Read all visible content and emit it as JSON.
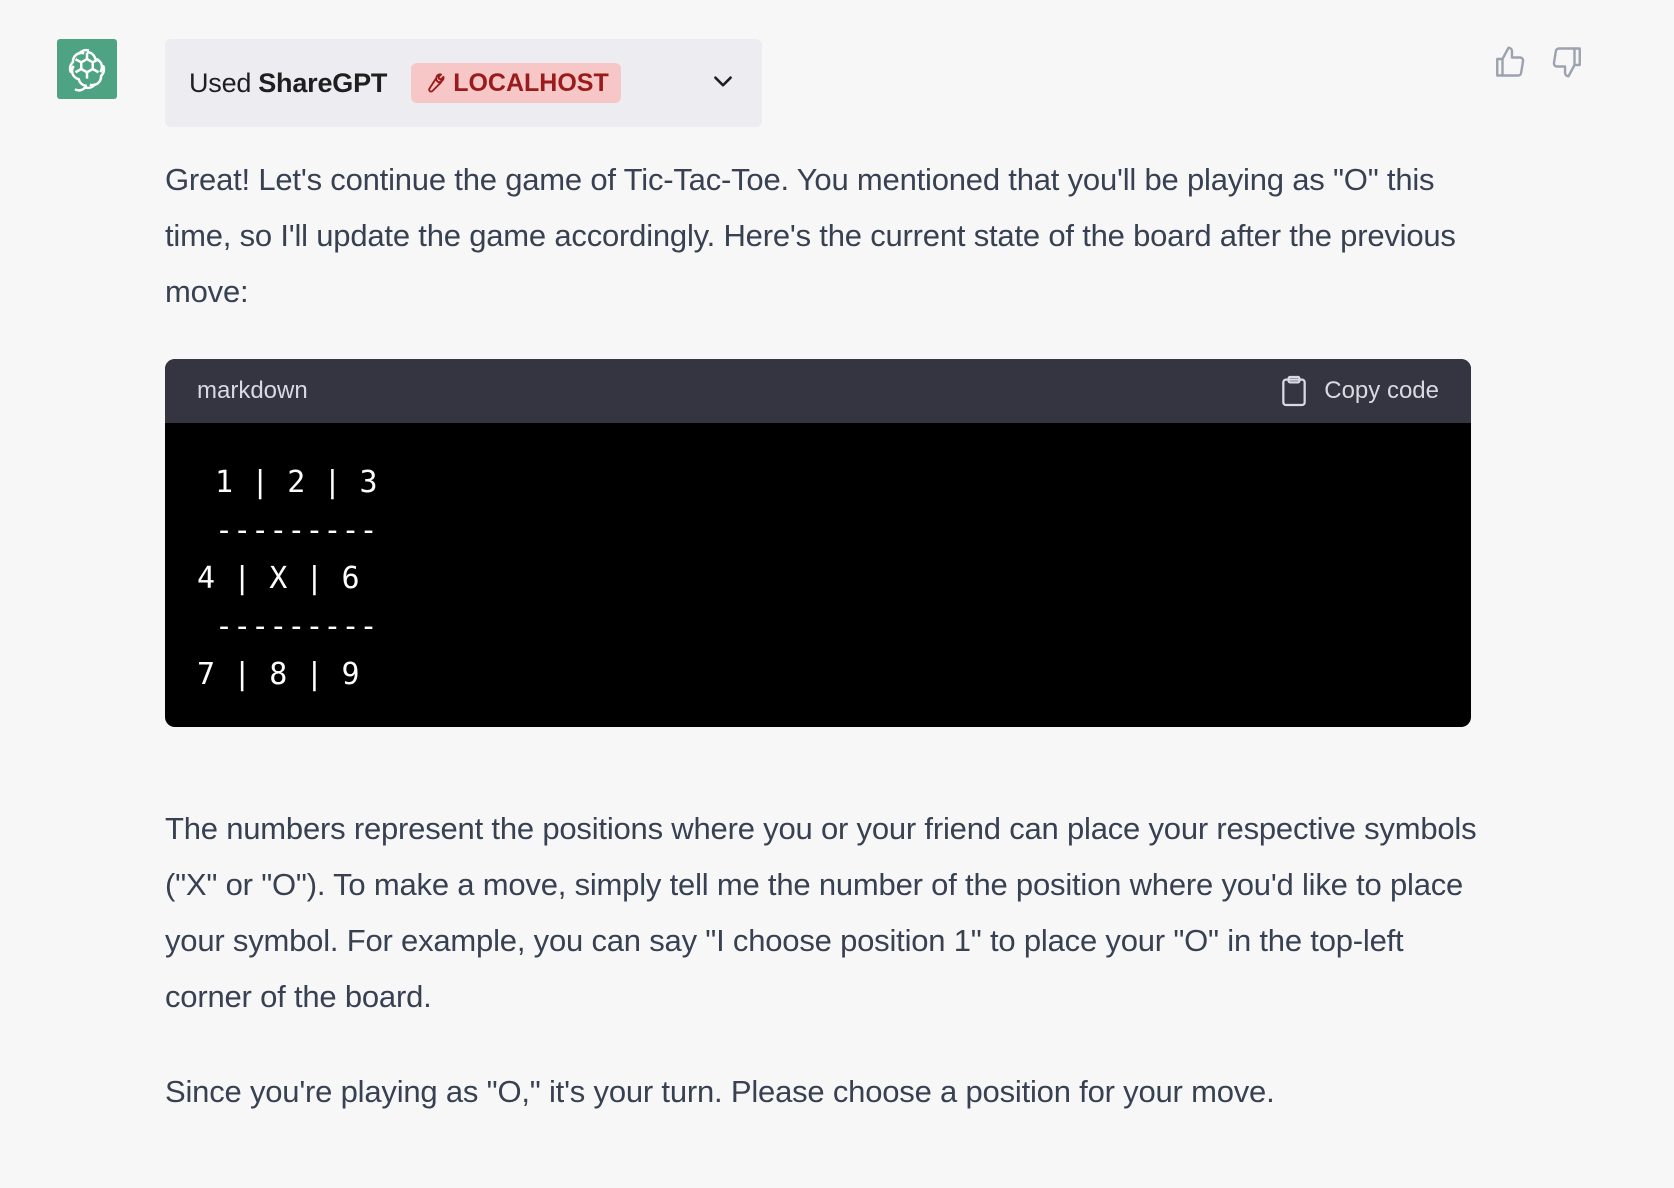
{
  "assistant": {
    "avatar_icon": "openai-logo-icon",
    "plugin": {
      "used_label": "Used",
      "name": "ShareGPT",
      "badge_label": "LOCALHOST",
      "badge_icon": "wrench-icon",
      "expand_icon": "chevron-down-icon"
    },
    "feedback": {
      "thumbs_up_icon": "thumbs-up-icon",
      "thumbs_down_icon": "thumbs-down-icon"
    }
  },
  "message": {
    "intro": "Great! Let's continue the game of Tic-Tac-Toe. You mentioned that you'll be playing as \"O\" this time, so I'll update the game accordingly. Here's the current state of the board after the previous move:",
    "code": {
      "language": "markdown",
      "copy_label": "Copy code",
      "lines": [
        " 1 | 2 | 3",
        " ---------",
        "4 | X | 6",
        " ---------",
        "7 | 8 | 9"
      ]
    },
    "explanation": "The numbers represent the positions where you or your friend can place your respective symbols (\"X\" or \"O\"). To make a move, simply tell me the number of the position where you'd like to place your symbol. For example, you can say \"I choose position 1\" to place your \"O\" in the top-left corner of the board.",
    "closing": "Since you're playing as \"O,\" it's your turn. Please choose a position for your move."
  },
  "colors": {
    "background": "#f7f7f8",
    "avatar": "#4ea383",
    "badge_bg": "#f7c6c6",
    "badge_text": "#991b1b",
    "code_header": "#343541",
    "code_bg": "#000000"
  }
}
